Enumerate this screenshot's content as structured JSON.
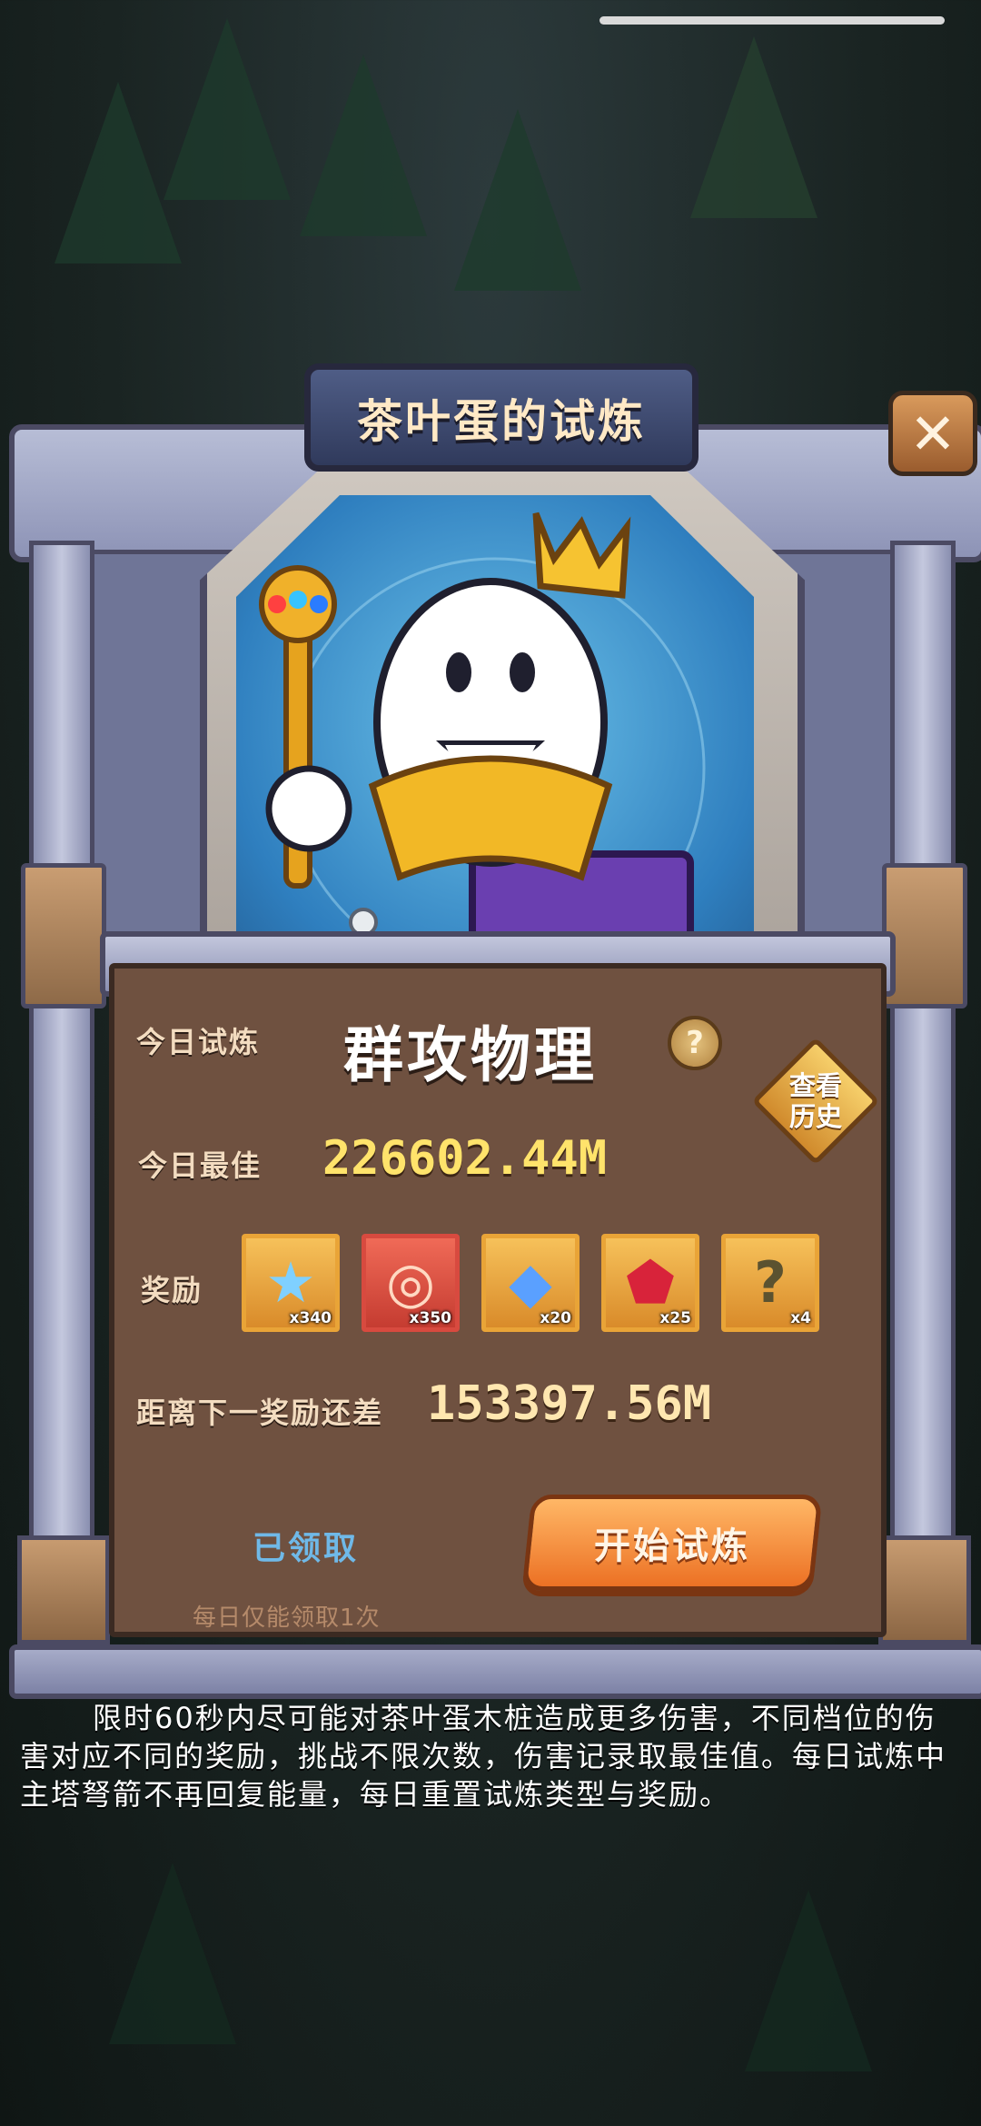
{
  "dialog": {
    "title": "茶叶蛋的试炼",
    "close_icon": "close-icon"
  },
  "trial": {
    "today_label": "今日试炼",
    "today_type": "群攻物理",
    "help_label": "?",
    "history_label": "查看历史",
    "best_label": "今日最佳",
    "best_value": "226602.44M",
    "reward_label": "奖励",
    "next_label": "距离下一奖励还差",
    "next_value": "153397.56M"
  },
  "rewards": [
    {
      "icon": "rainbow-star-icon",
      "count": "x340"
    },
    {
      "icon": "candy-orb-icon",
      "count": "x350"
    },
    {
      "icon": "puzzle-piece-icon",
      "count": "x20"
    },
    {
      "icon": "red-crystal-icon",
      "count": "x25"
    },
    {
      "icon": "mystery-box-icon",
      "count": "x4"
    }
  ],
  "actions": {
    "claimed_label": "已领取",
    "daily_limit_note": "每日仅能领取1次",
    "start_button": "开始试炼"
  },
  "description": "限时60秒内尽可能对茶叶蛋木桩造成更多伤害，不同档位的伤害对应不同的奖励，挑战不限次数，伤害记录取最佳值。每日试炼中主塔弩箭不再回复能量，每日重置试炼类型与奖励。",
  "colors": {
    "accent_gold": "#ffe36b",
    "start_button": "#ec7124",
    "claimed_blue": "#6fb9e8",
    "board_brown": "#6f5140"
  }
}
